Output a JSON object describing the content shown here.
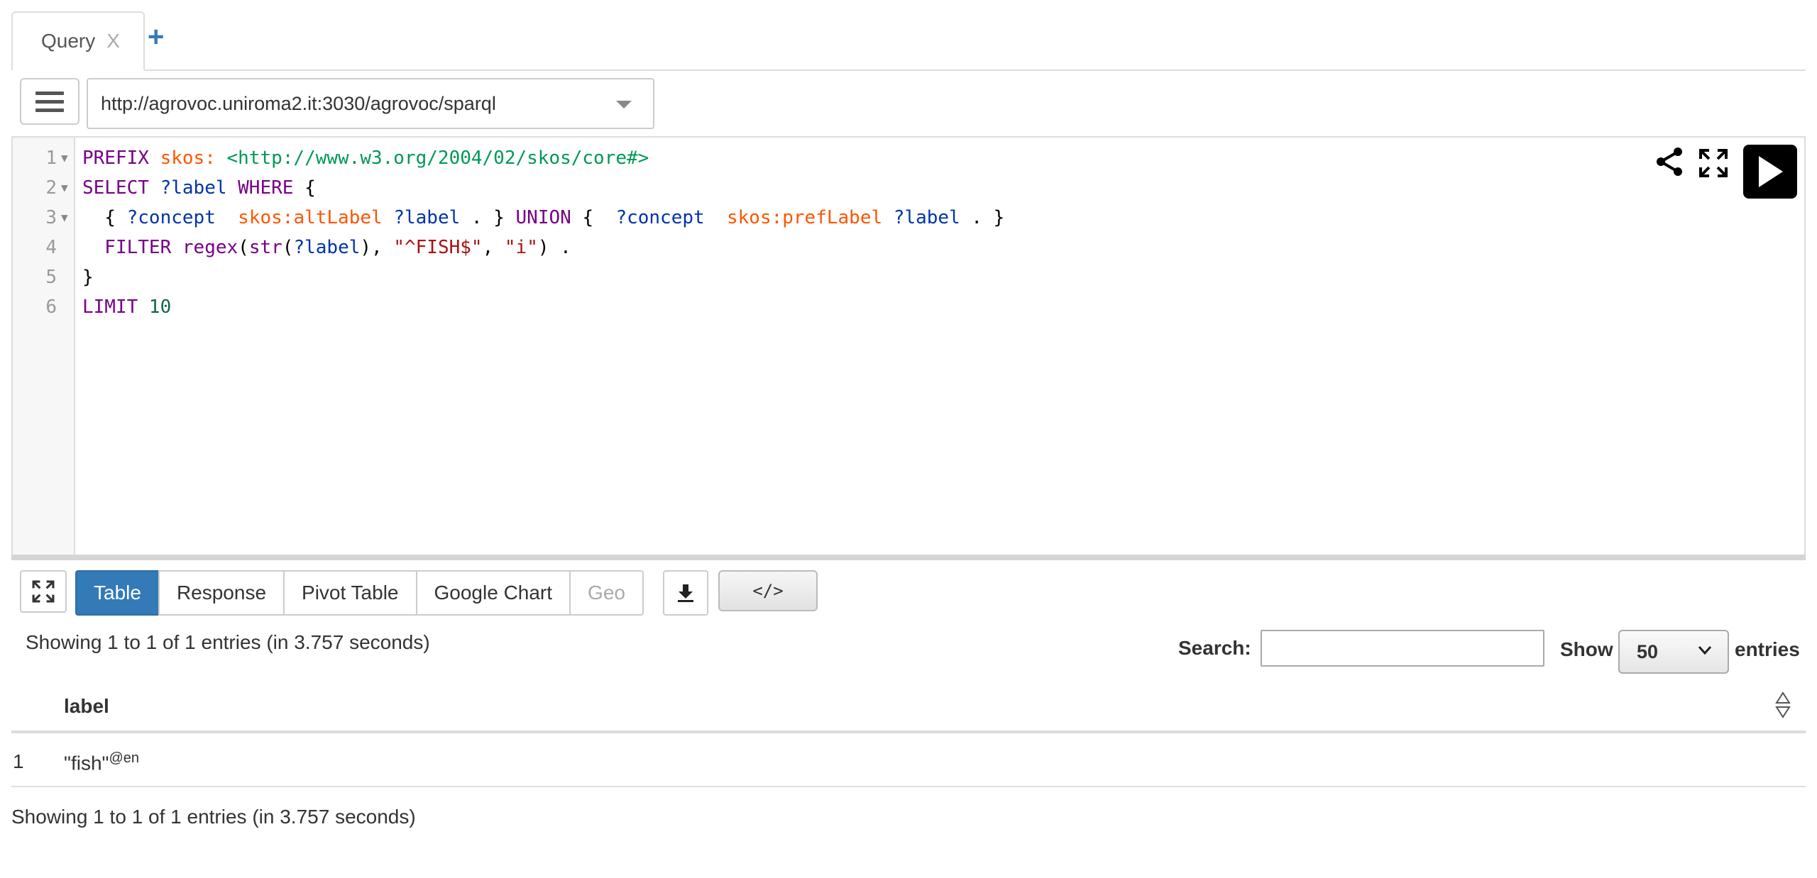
{
  "tabs": [
    {
      "label": "Query",
      "close": "X"
    }
  ],
  "add_tab": "+",
  "endpoint": {
    "url": "http://agrovoc.uniroma2.it:3030/agrovoc/sparql"
  },
  "editor": {
    "lines": [
      {
        "n": "1",
        "fold": "▼",
        "tokens": [
          {
            "t": "PREFIX ",
            "c": "kw"
          },
          {
            "t": "skos: ",
            "c": "pfx"
          },
          {
            "t": "<http://www.w3.org/2004/02/skos/core#>",
            "c": "uri"
          }
        ]
      },
      {
        "n": "2",
        "fold": "▼",
        "tokens": [
          {
            "t": "SELECT ",
            "c": "kw"
          },
          {
            "t": "?label ",
            "c": "var"
          },
          {
            "t": "WHERE",
            "c": "kw"
          },
          {
            "t": " {",
            "c": ""
          }
        ]
      },
      {
        "n": "3",
        "fold": "▼",
        "tokens": [
          {
            "t": "  { ",
            "c": ""
          },
          {
            "t": "?concept  ",
            "c": "var"
          },
          {
            "t": "skos:altLabel ",
            "c": "pfx"
          },
          {
            "t": "?label ",
            "c": "var"
          },
          {
            "t": ". } ",
            "c": ""
          },
          {
            "t": "UNION",
            "c": "kw"
          },
          {
            "t": " {  ",
            "c": ""
          },
          {
            "t": "?concept  ",
            "c": "var"
          },
          {
            "t": "skos:prefLabel ",
            "c": "pfx"
          },
          {
            "t": "?label ",
            "c": "var"
          },
          {
            "t": ". }",
            "c": ""
          }
        ]
      },
      {
        "n": "4",
        "fold": "",
        "tokens": [
          {
            "t": "  FILTER ",
            "c": "kw"
          },
          {
            "t": "regex",
            "c": "kw"
          },
          {
            "t": "(",
            "c": ""
          },
          {
            "t": "str",
            "c": "kw"
          },
          {
            "t": "(",
            "c": ""
          },
          {
            "t": "?label",
            "c": "var"
          },
          {
            "t": "), ",
            "c": ""
          },
          {
            "t": "\"^FISH$\"",
            "c": "str"
          },
          {
            "t": ", ",
            "c": ""
          },
          {
            "t": "\"i\"",
            "c": "str"
          },
          {
            "t": ") .",
            "c": ""
          }
        ]
      },
      {
        "n": "5",
        "fold": "",
        "tokens": [
          {
            "t": "}",
            "c": ""
          }
        ]
      },
      {
        "n": "6",
        "fold": "",
        "tokens": [
          {
            "t": "LIMIT ",
            "c": "kw"
          },
          {
            "t": "10",
            "c": "num"
          }
        ]
      }
    ]
  },
  "view_tabs": [
    {
      "label": "Table",
      "state": "active"
    },
    {
      "label": "Response",
      "state": ""
    },
    {
      "label": "Pivot Table",
      "state": ""
    },
    {
      "label": "Google Chart",
      "state": ""
    },
    {
      "label": "Geo",
      "state": "disabled"
    }
  ],
  "embed_label": "</>",
  "results": {
    "info": "Showing 1 to 1 of 1 entries (in 3.757 seconds)",
    "search_label": "Search:",
    "search_value": "",
    "show_label": "Show",
    "page_size": "50",
    "entries_label": "entries",
    "columns": [
      "label"
    ],
    "rows": [
      {
        "n": "1",
        "value": "\"fish\"",
        "lang": "@en"
      }
    ]
  },
  "colors": {
    "accent": "#337ab7",
    "run_button": "#000000"
  },
  "icons": {
    "menu": "hamburger-icon",
    "share": "share-icon",
    "fullscreen": "fullscreen-icon",
    "run": "play-icon",
    "download": "download-icon",
    "sort": "sort-icon"
  }
}
